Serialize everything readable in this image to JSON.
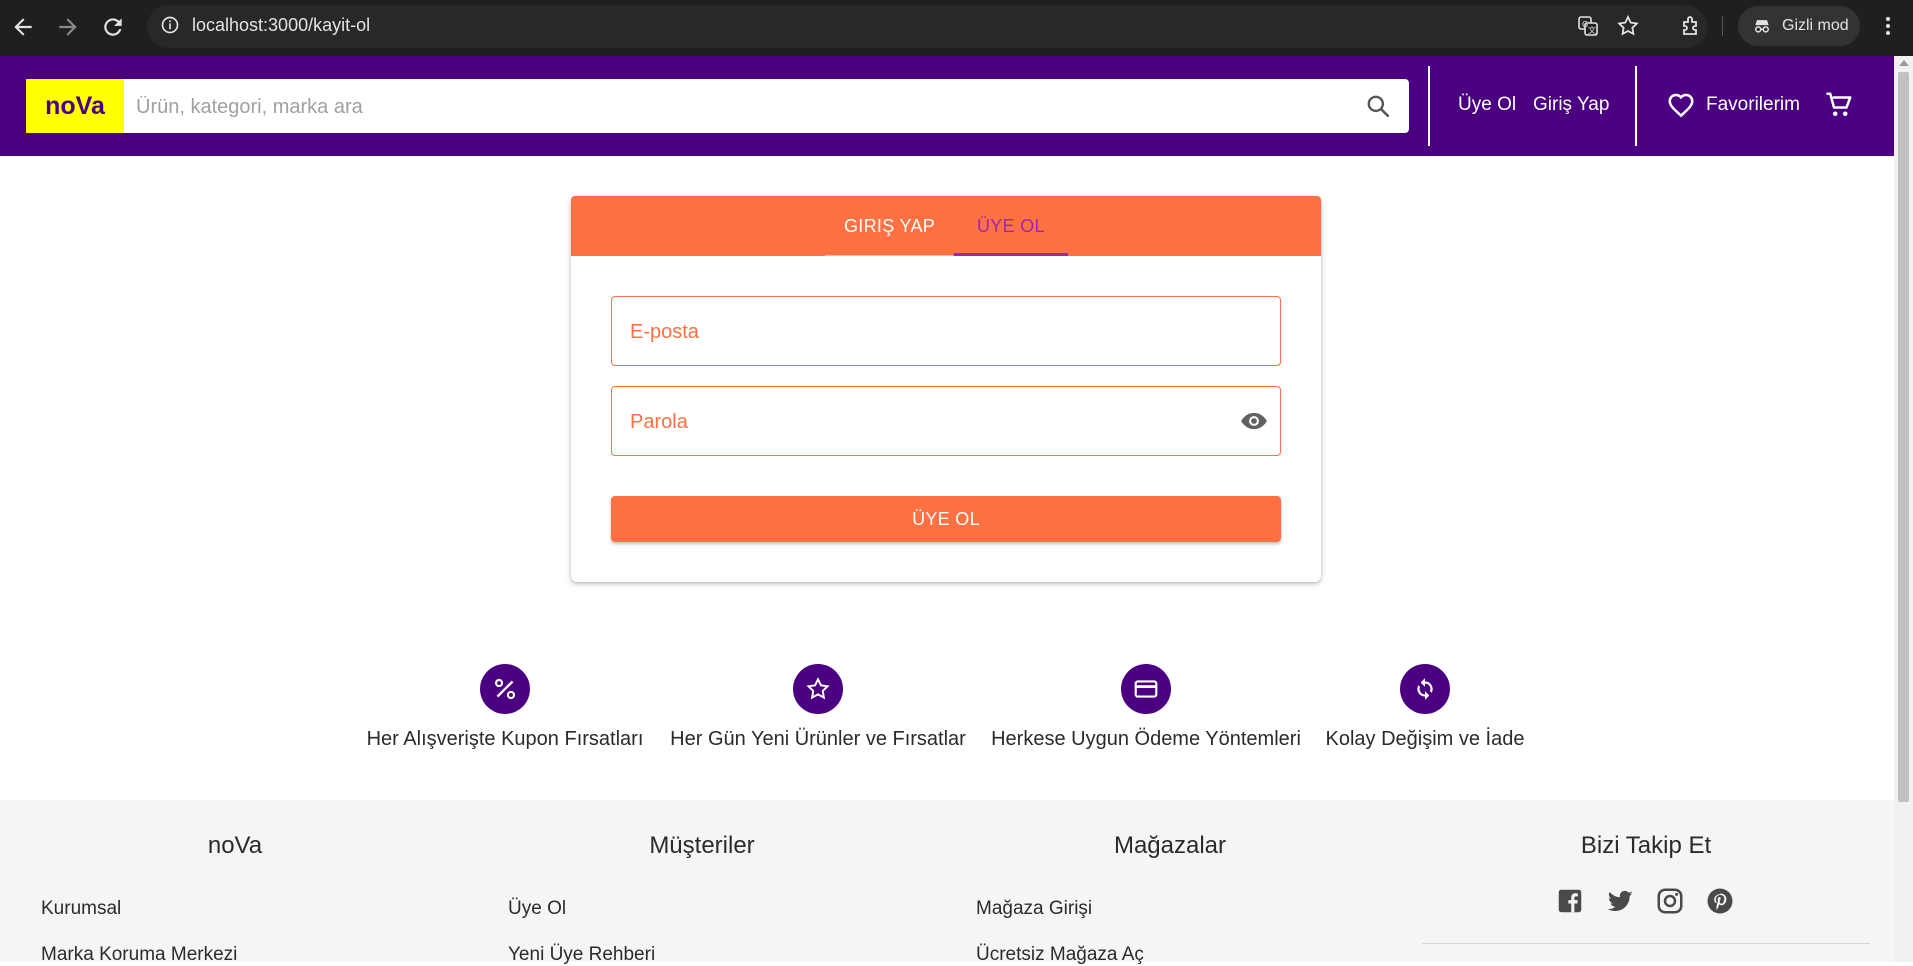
{
  "browser": {
    "url": "localhost:3000/kayit-ol",
    "incognito_label": "Gizli mod"
  },
  "header": {
    "logo": "noVa",
    "search_placeholder": "Ürün, kategori, marka ara",
    "signup_link": "Üye Ol",
    "login_link": "Giriş Yap",
    "favorites": "Favorilerim"
  },
  "auth": {
    "tabs": [
      {
        "label": "GIRIŞ YAP",
        "active": false
      },
      {
        "label": "ÜYE OL",
        "active": true
      }
    ],
    "email_placeholder": "E-posta",
    "password_placeholder": "Parola",
    "submit_label": "ÜYE OL"
  },
  "features": [
    {
      "label": "Her Alışverişte Kupon Fırsatları",
      "icon": "percent-icon"
    },
    {
      "label": "Her Gün Yeni Ürünler ve Fırsatlar",
      "icon": "star-icon"
    },
    {
      "label": "Herkese Uygun Ödeme Yöntemleri",
      "icon": "credit-card-icon"
    },
    {
      "label": "Kolay Değişim ve İade",
      "icon": "refresh-icon"
    }
  ],
  "footer": {
    "columns": [
      {
        "title": "noVa",
        "links": [
          "Kurumsal",
          "Marka Koruma Merkezi"
        ]
      },
      {
        "title": "Müşteriler",
        "links": [
          "Üye Ol",
          "Yeni Üye Rehberi"
        ]
      },
      {
        "title": "Mağazalar",
        "links": [
          "Mağaza Girişi",
          "Ücretsiz Mağaza Aç"
        ]
      },
      {
        "title": "Bizi Takip Et",
        "links": []
      }
    ],
    "social_icons": [
      "facebook-icon",
      "twitter-icon",
      "instagram-icon",
      "pinterest-icon"
    ]
  },
  "colors": {
    "brand_purple": "#4b0082",
    "accent_orange": "#ff7043",
    "logo_yellow": "#ffff00",
    "active_tab": "#9c27b0"
  }
}
